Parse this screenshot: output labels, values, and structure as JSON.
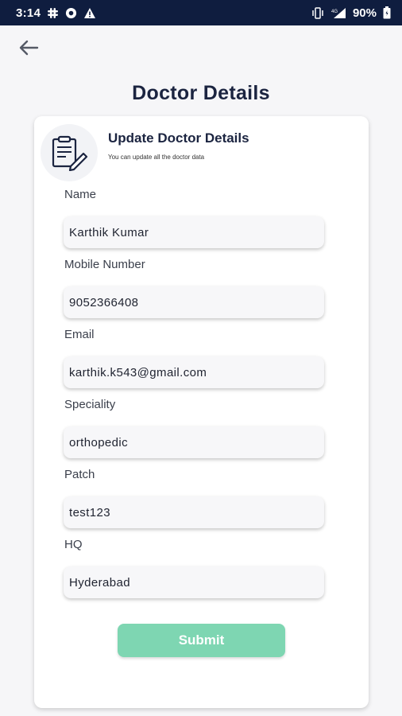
{
  "status_bar": {
    "time": "3:14",
    "battery_percent": "90%",
    "background_color": "#0f1d3f"
  },
  "header": {
    "back_icon": "arrow-left-icon",
    "title": "Doctor Details"
  },
  "card": {
    "icon": "clipboard-edit-icon",
    "title": "Update Doctor Details",
    "subtitle": "You can update all the doctor data"
  },
  "form": {
    "fields": [
      {
        "label": "Name",
        "value": "Karthik Kumar"
      },
      {
        "label": "Mobile Number",
        "value": "9052366408"
      },
      {
        "label": "Email",
        "value": "karthik.k543@gmail.com"
      },
      {
        "label": "Speciality",
        "value": "orthopedic"
      },
      {
        "label": "Patch",
        "value": "test123"
      },
      {
        "label": "HQ",
        "value": "Hyderabad"
      }
    ],
    "submit_label": "Submit",
    "submit_color": "#7ed6b2"
  }
}
